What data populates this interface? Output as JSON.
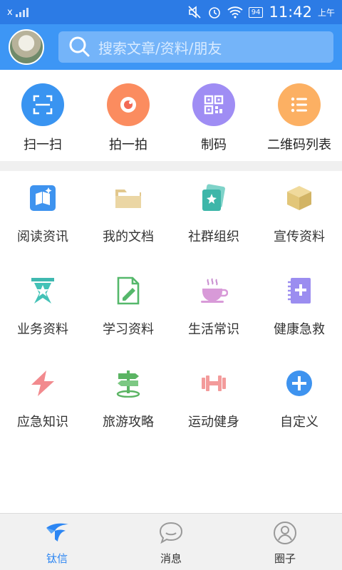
{
  "status_bar": {
    "carrier": "x",
    "battery": "94",
    "time": "11:42",
    "ampm": "上午"
  },
  "header": {
    "search_placeholder": "搜索文章/资料/朋友"
  },
  "quick_actions": [
    {
      "label": "扫一扫",
      "icon": "scan-icon",
      "color": "#3994f1"
    },
    {
      "label": "拍一拍",
      "icon": "camera-icon",
      "color": "#fb8c5f"
    },
    {
      "label": "制码",
      "icon": "qrcode-icon",
      "color": "#9f8df4"
    },
    {
      "label": "二维码列表",
      "icon": "list-icon",
      "color": "#fcb063"
    }
  ],
  "grid": [
    {
      "label": "阅读资讯",
      "icon": "reading-icon"
    },
    {
      "label": "我的文档",
      "icon": "folder-icon"
    },
    {
      "label": "社群组织",
      "icon": "community-icon"
    },
    {
      "label": "宣传资料",
      "icon": "box-icon"
    },
    {
      "label": "业务资料",
      "icon": "business-icon"
    },
    {
      "label": "学习资料",
      "icon": "study-icon"
    },
    {
      "label": "生活常识",
      "icon": "coffee-icon"
    },
    {
      "label": "健康急救",
      "icon": "first-aid-icon"
    },
    {
      "label": "应急知识",
      "icon": "lightning-icon"
    },
    {
      "label": "旅游攻略",
      "icon": "signpost-icon"
    },
    {
      "label": "运动健身",
      "icon": "dumbbell-icon"
    },
    {
      "label": "自定义",
      "icon": "add-icon"
    }
  ],
  "tabs": [
    {
      "label": "钛信",
      "active": true
    },
    {
      "label": "消息",
      "active": false
    },
    {
      "label": "圈子",
      "active": false
    }
  ]
}
